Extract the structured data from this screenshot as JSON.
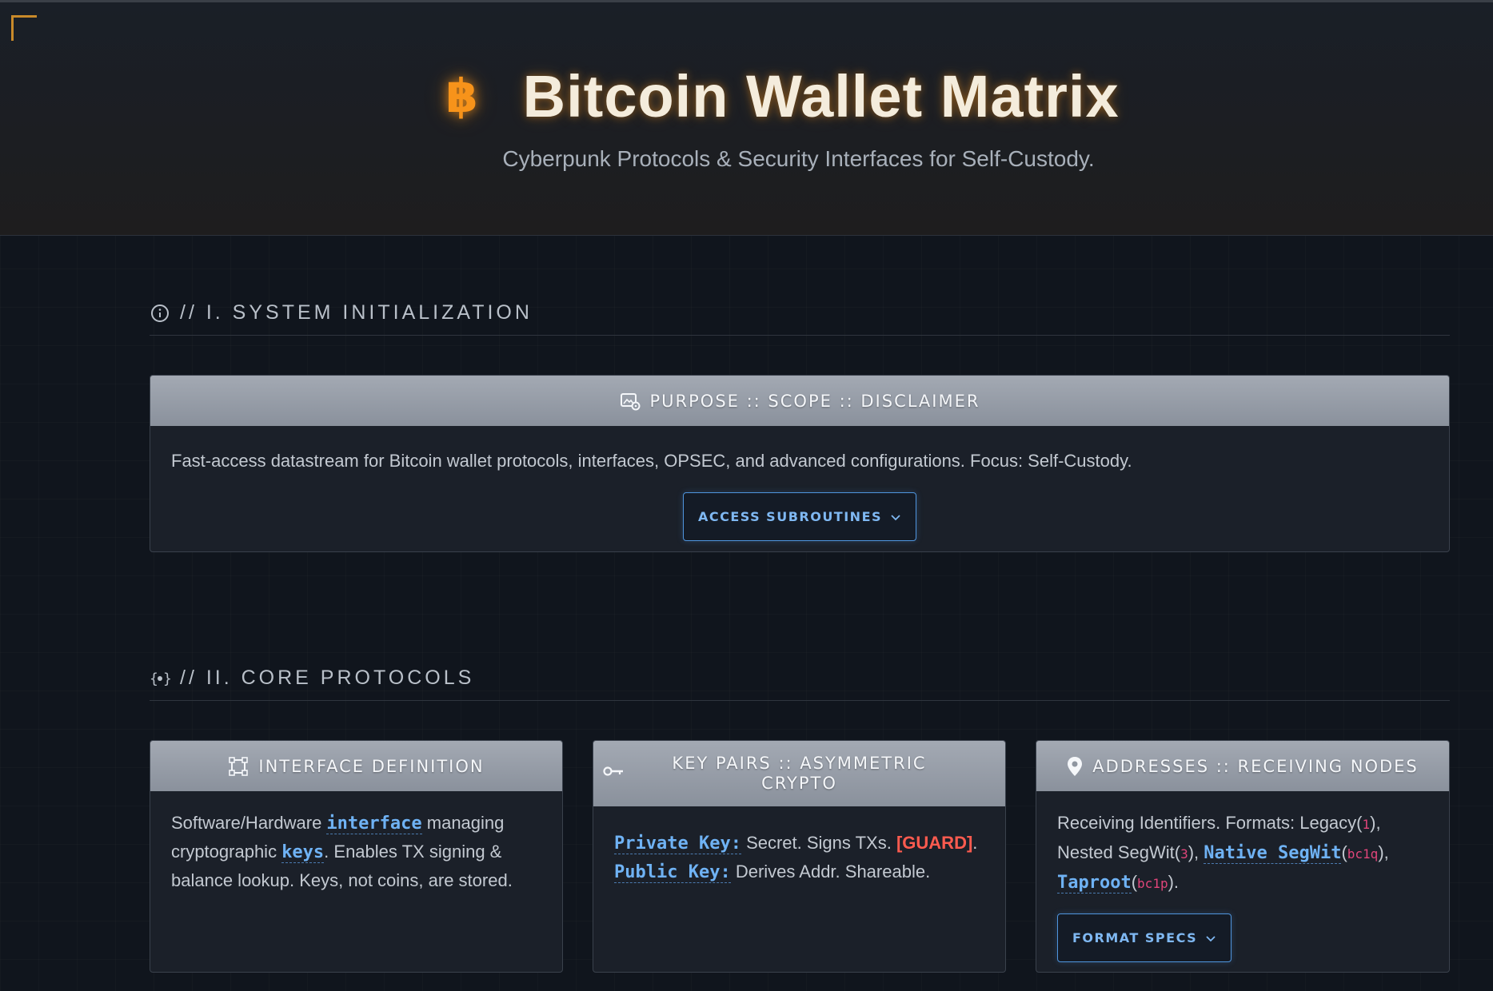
{
  "header": {
    "btc_symbol": "฿",
    "title": "Bitcoin Wallet Matrix",
    "subtitle": "Cyberpunk Protocols & Security Interfaces for Self-Custody."
  },
  "section1": {
    "title": "// I. SYSTEM INITIALIZATION",
    "card": {
      "heading": "PURPOSE :: SCOPE :: DISCLAIMER",
      "text": "Fast-access datastream for Bitcoin wallet protocols, interfaces, OPSEC, and advanced configurations. Focus: Self-Custody.",
      "button_label": "ACCESS SUBROUTINES"
    }
  },
  "section2": {
    "title": "// II. CORE PROTOCOLS",
    "cards": [
      {
        "heading": "INTERFACE DEFINITION",
        "t1": "Software/Hardware ",
        "kw1": "interface",
        "t2": " managing cryptographic ",
        "kw2": "keys",
        "t3": ". Enables TX signing & balance lookup. Keys, not coins, are stored."
      },
      {
        "heading": "KEY PAIRS :: ASYMMETRIC CRYPTO",
        "kw1": "Private Key:",
        "t1": " Secret. Signs TXs. ",
        "guard": "[GUARD]",
        "t2": ".",
        "kw2": "Public Key:",
        "t3": " Derives Addr. Shareable."
      },
      {
        "heading": "ADDRESSES :: RECEIVING NODES",
        "t1": "Receiving Identifiers. Formats: Legacy(",
        "c1": "1",
        "t2": "), Nested SegWit(",
        "c2": "3",
        "t3": "), ",
        "kw1": "Native SegWit",
        "t3b": "(",
        "c3": "bc1q",
        "t4": "), ",
        "kw2": "Taproot",
        "t4b": "(",
        "c4": "bc1p",
        "t5": ").",
        "button_label": "FORMAT SPECS"
      }
    ]
  },
  "colors": {
    "accent_orange": "#f7931a",
    "link_blue": "#6fb2f4",
    "guard_red": "#ff5b4f",
    "code_pink": "#e0457a"
  }
}
